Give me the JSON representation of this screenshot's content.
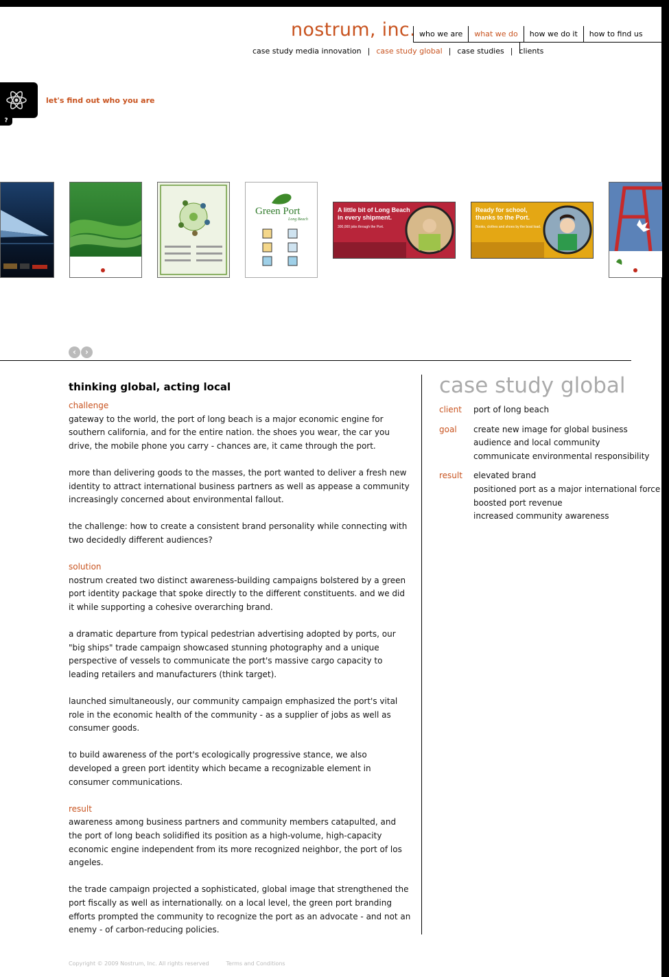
{
  "header": {
    "logo": "nostrum, inc.",
    "main_nav": [
      {
        "label": "who we are",
        "active": false
      },
      {
        "label": "what we do",
        "active": true
      },
      {
        "label": "how we do it",
        "active": false
      },
      {
        "label": "how to find us",
        "active": false
      }
    ],
    "sub_nav": [
      {
        "label": "case study media innovation",
        "active": false
      },
      {
        "label": "case study global",
        "active": true
      },
      {
        "label": "case studies",
        "active": false
      },
      {
        "label": "clients",
        "active": false
      }
    ]
  },
  "intro": {
    "tagline": "let's find out who you are",
    "help_label": "?"
  },
  "gallery": {
    "items": [
      {
        "name": "big ships ad"
      },
      {
        "name": "green port brochure"
      },
      {
        "name": "thinking green poster"
      },
      {
        "name": "green port identity",
        "logo_text": "Green Port",
        "logo_sub": "Long Beach"
      },
      {
        "name": "community ad long beach",
        "headline": "A little bit of Long Beach in every shipment.",
        "sub": "300,000 jobs through the Port."
      },
      {
        "name": "community ad school",
        "headline": "Ready for school, thanks to the Port.",
        "sub": "Books, clothes and shoes by the boat load."
      },
      {
        "name": "crane ad"
      }
    ],
    "prev_label": "‹",
    "next_label": "›"
  },
  "article": {
    "title": "thinking global, acting local",
    "sections": [
      {
        "heading": "challenge",
        "paragraphs": [
          "gateway to the world, the port of long beach is a major economic engine for southern california, and for the entire nation. the shoes you wear, the car you drive, the mobile phone you carry - chances are, it came through the port.",
          "more than delivering goods to the masses, the port wanted to deliver a fresh new identity to attract international business partners as well as appease a community increasingly concerned about environmental fallout.",
          "the challenge: how to create a consistent brand personality while connecting with two decidedly different audiences?"
        ]
      },
      {
        "heading": "solution",
        "paragraphs": [
          "nostrum created two distinct awareness-building campaigns bolstered by a green port identity package that spoke directly to the different constituents. and we did it while supporting a cohesive overarching brand.",
          "a dramatic departure from typical pedestrian advertising adopted by ports, our \"big ships\" trade campaign showcased stunning photography and a unique perspective of vessels to communicate the port's massive cargo capacity to leading retailers and manufacturers (think target).",
          "launched simultaneously, our community campaign emphasized the port's vital role in the economic health of the community - as a supplier of jobs as well as consumer goods.",
          "to build awareness of the port's ecologically progressive stance, we also developed a green port identity which became a recognizable element in consumer communications."
        ]
      },
      {
        "heading": "result",
        "paragraphs": [
          "awareness among business partners and community members catapulted, and the port of long beach solidified its position as a high-volume, high-capacity economic engine independent from its more recognized neighbor, the port of los angeles.",
          "the trade campaign projected a sophisticated, global image that strengthened the port fiscally as well as internationally. on a local level, the green port branding efforts prompted the community to recognize the port as an advocate - and not an enemy - of carbon-reducing policies."
        ]
      }
    ]
  },
  "sidebar": {
    "title": "case study global",
    "facts": [
      {
        "label": "client",
        "values": [
          "port of long beach"
        ]
      },
      {
        "label": "goal",
        "values": [
          "create new image for global business",
          "audience and local community",
          "communicate environmental responsibility"
        ]
      },
      {
        "label": "result",
        "values": [
          "elevated brand",
          "positioned port as a major international force",
          "boosted port revenue",
          "increased community awareness"
        ]
      }
    ]
  },
  "footer": {
    "copyright": "Copyright © 2009 Nostrum, Inc. All rights reserved",
    "terms": "Terms and Conditions"
  },
  "colors": {
    "accent": "#c8531f",
    "gray_title": "#aaaaaa",
    "black": "#000000"
  }
}
